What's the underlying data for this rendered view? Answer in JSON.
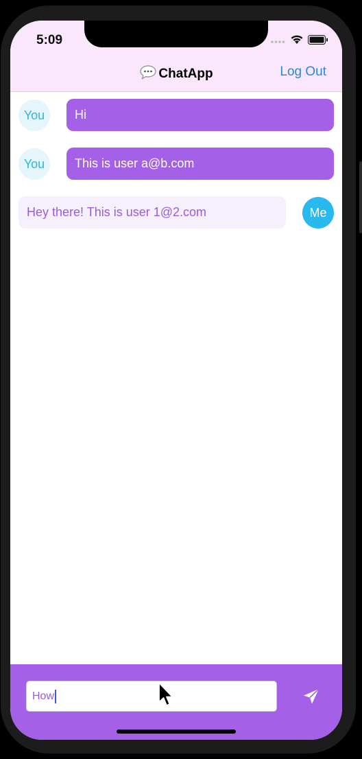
{
  "status_bar": {
    "time": "5:09"
  },
  "header": {
    "title": "ChatApp",
    "logout_label": "Log Out",
    "background": "#fbe7fb",
    "link_color": "#2a86e0"
  },
  "messages": [
    {
      "sender_label": "You",
      "text": "Hi",
      "from_me": false
    },
    {
      "sender_label": "You",
      "text": "This is user a@b.com",
      "from_me": false
    },
    {
      "sender_label": "Me",
      "text": "Hey there! This is user 1@2.com",
      "from_me": true
    }
  ],
  "composer": {
    "input_value": "How",
    "send_icon": "paper-plane-icon",
    "background": "#a460e6"
  },
  "colors": {
    "accent": "#a460e6",
    "you_avatar_bg": "#e4f6fb",
    "me_avatar_bg": "#29b9ee"
  }
}
